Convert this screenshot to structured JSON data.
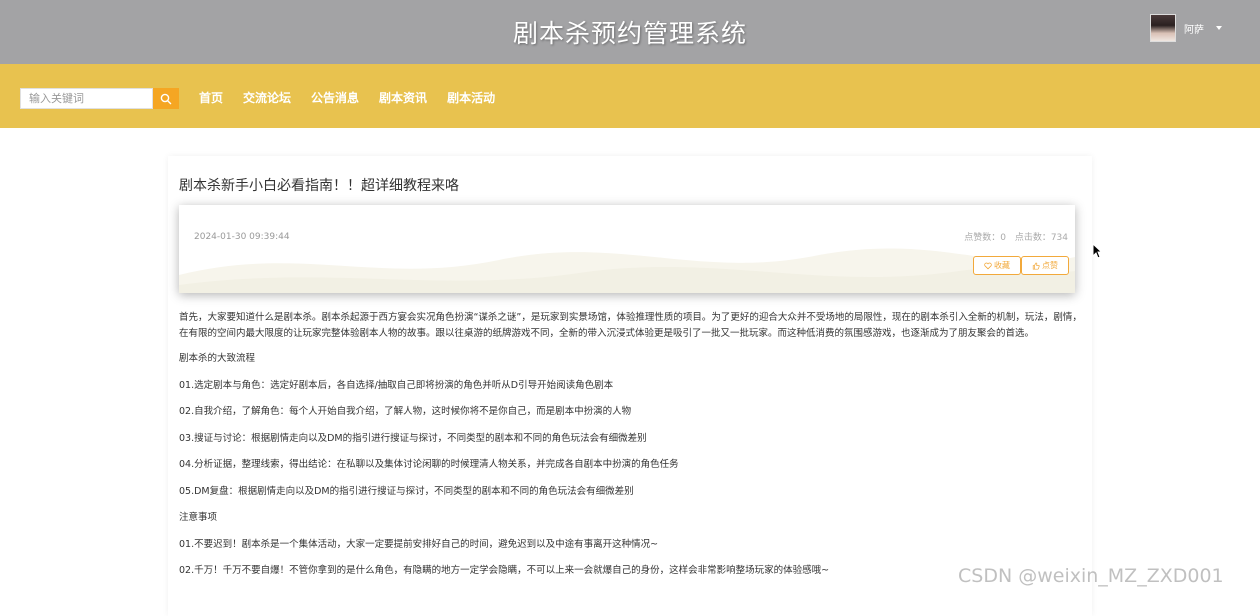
{
  "header": {
    "site_title": "剧本杀预约管理系统",
    "username": "阿萨"
  },
  "nav": {
    "search_placeholder": "输入关键词",
    "links": [
      "首页",
      "交流论坛",
      "公告消息",
      "剧本资讯",
      "剧本活动"
    ]
  },
  "article": {
    "title": "剧本杀新手小白必看指南！！超详细教程来咯",
    "date": "2024-01-30 09:39:44",
    "likes_label": "点赞数：0",
    "clicks_label": "点击数：734",
    "favorite_label": "收藏",
    "like_label": "点赞",
    "paragraphs": [
      "首先，大家要知道什么是剧本杀。剧本杀起源于西方宴会实况角色扮演“谋杀之谜”，是玩家到实景场馆，体验推理性质的项目。为了更好的迎合大众并不受场地的局限性，现在的剧本杀引入全新的机制，玩法，剧情，在有限的空间内最大限度的让玩家完整体验剧本人物的故事。跟以往桌游的纸牌游戏不同，全新的带入沉浸式体验更是吸引了一批又一批玩家。而这种低消费的氛围感游戏，也逐渐成为了朋友聚会的首选。",
      "剧本杀的大致流程",
      "01.选定剧本与角色：选定好剧本后，各自选择/抽取自己即将扮演的角色并听从D引导开始阅读角色剧本",
      "02.自我介绍，了解角色：每个人开始自我介绍，了解人物，这时候你将不是你自己，而是剧本中扮演的人物",
      "03.搜证与讨论：根据剧情走向以及DM的指引进行搜证与探讨，不同类型的剧本和不同的角色玩法会有细微差别",
      "04.分析证据，整理线索，得出结论：在私聊以及集体讨论闲聊的时候理清人物关系，并完成各自剧本中扮演的角色任务",
      "05.DM复盘：根据剧情走向以及DM的指引进行搜证与探讨，不同类型的剧本和不同的角色玩法会有细微差别",
      "注意事项",
      "01.不要迟到！剧本杀是一个集体活动，大家一定要提前安排好自己的时间，避免迟到以及中途有事离开这种情况~",
      "02.千万！千万不要自爆！不管你拿到的是什么角色，有隐瞒的地方一定学会隐瞒，不可以上来一会就爆自己的身份，这样会非常影响整场玩家的体验感哦~"
    ]
  },
  "watermark": "CSDN @weixin_MZ_ZXD001",
  "colors": {
    "header_bg": "#a3a3a5",
    "nav_bg": "#e8c24f",
    "accent": "#f5a623"
  }
}
